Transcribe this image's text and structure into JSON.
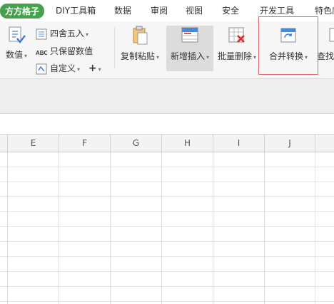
{
  "tabs": [
    {
      "label": "方方格子",
      "active": true
    },
    {
      "label": "DIY工具箱",
      "active": false
    },
    {
      "label": "数据",
      "active": false
    },
    {
      "label": "审阅",
      "active": false
    },
    {
      "label": "视图",
      "active": false
    },
    {
      "label": "安全",
      "active": false
    },
    {
      "label": "开发工具",
      "active": false
    },
    {
      "label": "特色应",
      "active": false
    }
  ],
  "ribbon": {
    "numeric_label": "数值",
    "round_label": "四舍五入",
    "keep_values_label": "只保留数值",
    "custom_label": "自定义",
    "plus_label": "+",
    "copy_paste_label": "复制粘贴",
    "insert_label": "新增插入",
    "batch_delete_label": "批量删除",
    "merge_convert_label": "合并转换",
    "find_label": "查找"
  },
  "sheet": {
    "columns": [
      "E",
      "F",
      "G",
      "H",
      "I",
      "J"
    ]
  },
  "colors": {
    "accent": "#44a24a",
    "highlight": "#e26464"
  }
}
